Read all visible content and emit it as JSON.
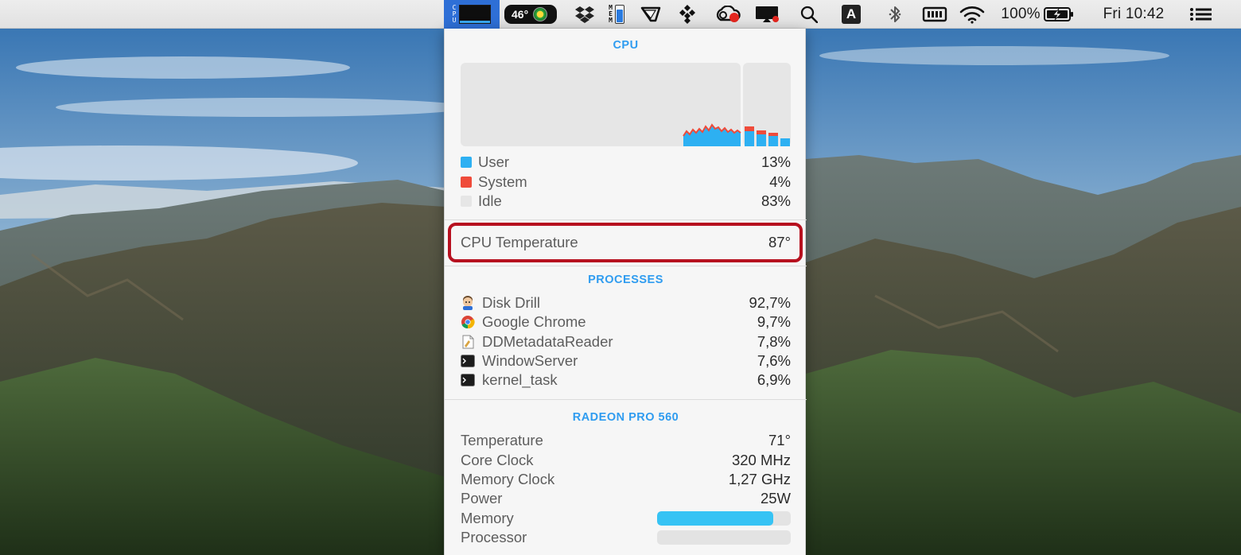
{
  "menubar": {
    "cpu_label": [
      "C",
      "P",
      "U"
    ],
    "temp_badge": "46°",
    "mem_label": [
      "M",
      "E",
      "M"
    ],
    "input_source": "A",
    "battery_percent": "100%",
    "clock": "Fri 10:42"
  },
  "cpu": {
    "title": "CPU",
    "stats": [
      {
        "label": "User",
        "value": "13%",
        "color": "#2db0f2"
      },
      {
        "label": "System",
        "value": "4%",
        "color": "#ef4b3a"
      },
      {
        "label": "Idle",
        "value": "83%",
        "color": "#e6e6e6"
      }
    ],
    "temperature_label": "CPU Temperature",
    "temperature_value": "87°",
    "colors": {
      "user": "#2db0f2",
      "system": "#ef4b3a",
      "graph_bg": "#e6e6e6"
    }
  },
  "processes": {
    "title": "PROCESSES",
    "items": [
      {
        "name": "Disk Drill",
        "value": "92,7%",
        "icon": "disk-drill-icon"
      },
      {
        "name": "Google Chrome",
        "value": "9,7%",
        "icon": "chrome-icon"
      },
      {
        "name": "DDMetadataReader",
        "value": "7,8%",
        "icon": "document-icon"
      },
      {
        "name": "WindowServer",
        "value": "7,6%",
        "icon": "terminal-icon"
      },
      {
        "name": "kernel_task",
        "value": "6,9%",
        "icon": "terminal-icon"
      }
    ]
  },
  "gpu": {
    "title": "RADEON PRO 560",
    "rows": [
      {
        "label": "Temperature",
        "value": "71°"
      },
      {
        "label": "Core Clock",
        "value": "320 MHz"
      },
      {
        "label": "Memory Clock",
        "value": "1,27 GHz"
      },
      {
        "label": "Power",
        "value": "25W"
      }
    ],
    "memory_label": "Memory",
    "memory_fraction": 0.87,
    "processor_label": "Processor",
    "processor_fraction": 0.0
  }
}
